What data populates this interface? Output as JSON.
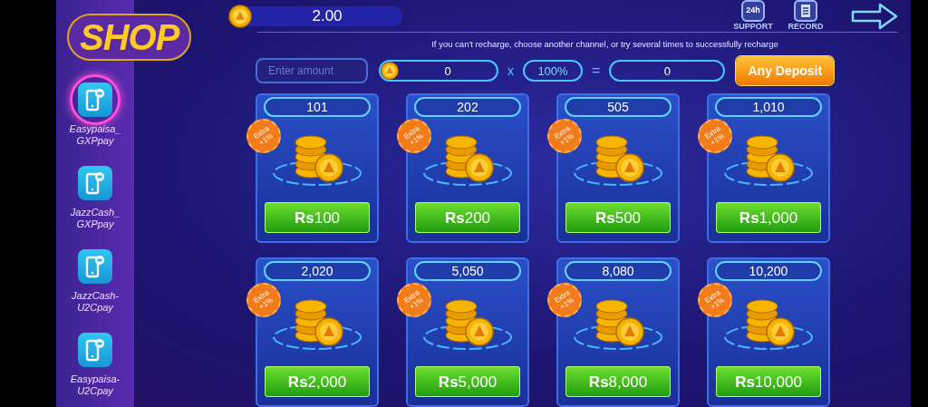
{
  "header": {
    "logo": "SHOP",
    "balance": "2.00",
    "actions": [
      {
        "kind": "support",
        "badge": "24h",
        "label": "SUPPORT"
      },
      {
        "kind": "record",
        "label": "RECORD"
      }
    ]
  },
  "notice": "If you can't recharge, choose another channel, or try several times to successfully recharge",
  "deposit": {
    "amount_placeholder": "Enter amount",
    "coins": "0",
    "times": "x",
    "percent": "100%",
    "equals": "=",
    "result": "0",
    "button": "Any Deposit"
  },
  "channels": [
    {
      "label": "Easypaisa_ GXPpay",
      "selected": true
    },
    {
      "label": "JazzCash_ GXPpay",
      "selected": false
    },
    {
      "label": "JazzCash- U2Cpay",
      "selected": false
    },
    {
      "label": "Easypaisa- U2Cpay",
      "selected": false
    }
  ],
  "packages": [
    {
      "coins": "101",
      "badge": "Extra +1%",
      "price": "**Rs**100"
    },
    {
      "coins": "202",
      "badge": "Extra +1%",
      "price": "**Rs**200"
    },
    {
      "coins": "505",
      "badge": "Extra +1%",
      "price": "**Rs**500"
    },
    {
      "coins": "1,010",
      "badge": "Extra +1%",
      "price": "**Rs**1,000"
    },
    {
      "coins": "2,020",
      "badge": "Extra +1%",
      "price": "**Rs**2,000"
    },
    {
      "coins": "5,050",
      "badge": "Extra +1%",
      "price": "**Rs**5,000"
    },
    {
      "coins": "8,080",
      "badge": "Extra +1%",
      "price": "**Rs**8,000"
    },
    {
      "coins": "10,200",
      "badge": "Extra +1%",
      "price": "**Rs**10,000"
    }
  ]
}
